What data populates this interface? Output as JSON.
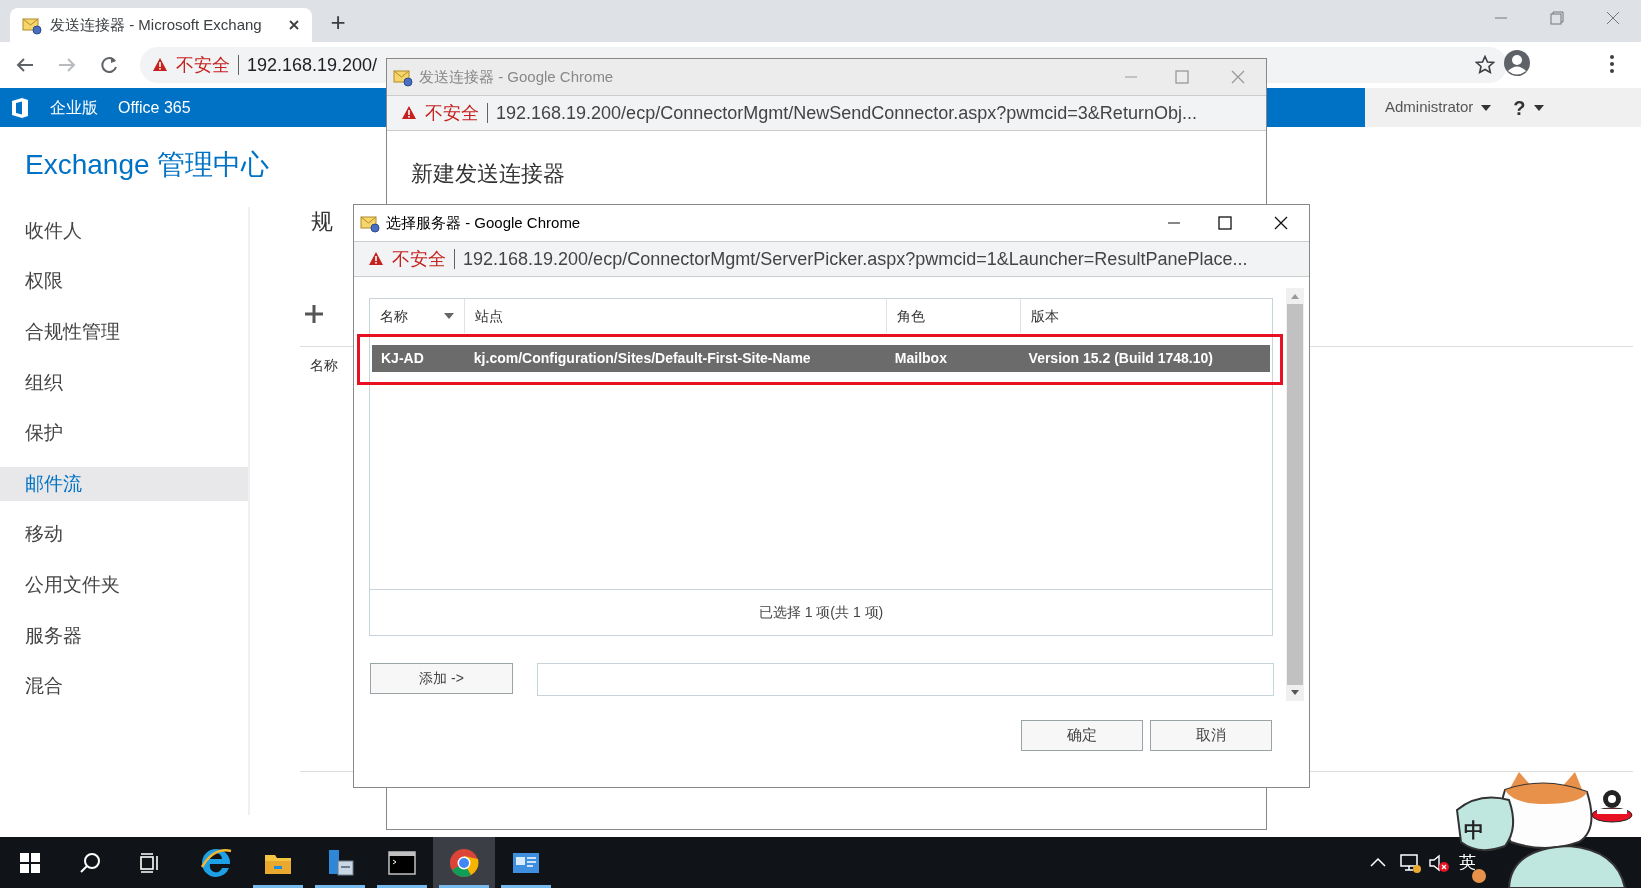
{
  "browser": {
    "tab_title": "发送连接器 - Microsoft Exchang",
    "new_tab": "+",
    "security": "不安全",
    "url": "192.168.19.200/"
  },
  "app_header": {
    "edition": "企业版",
    "office": "Office 365",
    "user": "Administrator",
    "help": "?"
  },
  "eac": {
    "title": "Exchange 管理中心",
    "nav": [
      {
        "label": "收件人",
        "selected": false
      },
      {
        "label": "权限",
        "selected": false
      },
      {
        "label": "合规性管理",
        "selected": false
      },
      {
        "label": "组织",
        "selected": false
      },
      {
        "label": "保护",
        "selected": false
      },
      {
        "label": "邮件流",
        "selected": true
      },
      {
        "label": "移动",
        "selected": false
      },
      {
        "label": "公用文件夹",
        "selected": false
      },
      {
        "label": "服务器",
        "selected": false
      },
      {
        "label": "混合",
        "selected": false
      }
    ],
    "page_title": "规",
    "column": "名称"
  },
  "popup_connector": {
    "title": "发送连接器 - Google Chrome",
    "security": "不安全",
    "url": "192.168.19.200/ecp/ConnectorMgmt/NewSendConnector.aspx?pwmcid=3&ReturnObj...",
    "heading": "新建发送连接器"
  },
  "popup_server_picker": {
    "title": "选择服务器 - Google Chrome",
    "security": "不安全",
    "url": "192.168.19.200/ecp/ConnectorMgmt/ServerPicker.aspx?pwmcid=1&Launcher=ResultPanePlace...",
    "columns": [
      "名称",
      "站点",
      "角色",
      "版本"
    ],
    "rows": [
      {
        "cells": [
          "KJ-AD",
          "kj.com/Configuration/Sites/Default-First-Site-Name",
          "Mailbox",
          "Version 15.2 (Build 1748.10)"
        ],
        "selected": true
      }
    ],
    "status": "已选择 1 项(共 1 项)",
    "add_button": "添加 ->",
    "ok_button": "确定",
    "cancel_button": "取消"
  },
  "taskbar": {
    "apps": [
      {
        "kind": "ie",
        "running": false,
        "active": false
      },
      {
        "kind": "explorer",
        "running": true,
        "active": false
      },
      {
        "kind": "server-manager",
        "running": true,
        "active": false
      },
      {
        "kind": "terminal",
        "running": true,
        "active": false
      },
      {
        "kind": "chrome",
        "running": true,
        "active": true
      },
      {
        "kind": "app",
        "running": true,
        "active": false
      }
    ],
    "ime": "中",
    "language": "英"
  }
}
